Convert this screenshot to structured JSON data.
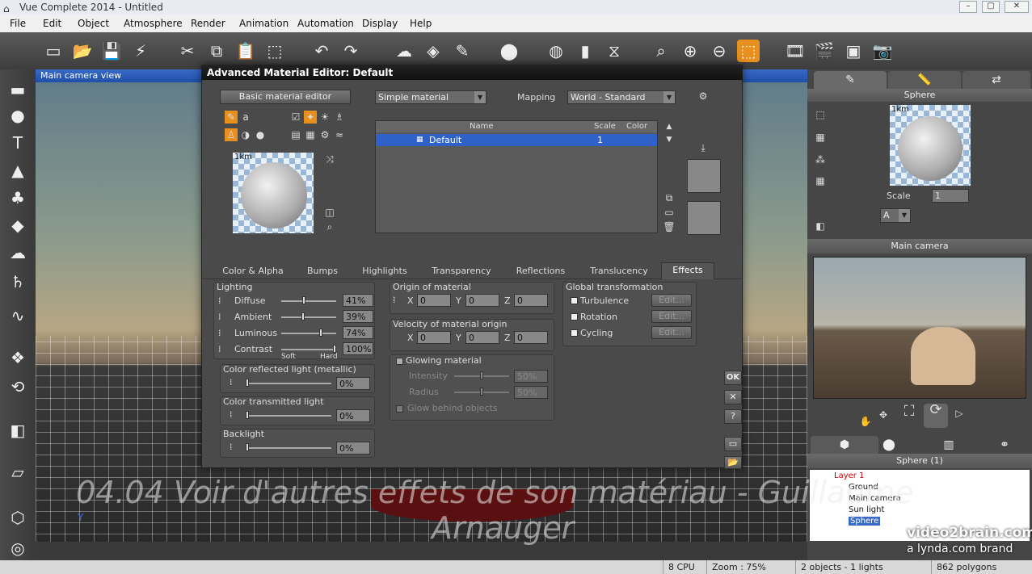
{
  "window": {
    "title": "Vue Complete 2014 - Untitled"
  },
  "menu": [
    "File",
    "Edit",
    "Object",
    "Atmosphere",
    "Render",
    "Animation",
    "Automation",
    "Display",
    "Help"
  ],
  "viewport": {
    "title": "Main camera view",
    "axis_y": "Y"
  },
  "dialog": {
    "title": "Advanced Material Editor: Default",
    "basic_editor_label": "Basic material editor",
    "material_type": "Simple material",
    "mapping_label": "Mapping",
    "mapping_value": "World - Standard",
    "preview_scale": "1km",
    "layers_table": {
      "columns": [
        "Name",
        "Scale",
        "Color"
      ],
      "rows": [
        {
          "name": "Default",
          "scale": "1",
          "color": ""
        }
      ]
    },
    "tabs": [
      "Color & Alpha",
      "Bumps",
      "Highlights",
      "Transparency",
      "Reflections",
      "Translucency",
      "Effects"
    ],
    "active_tab": "Effects",
    "lighting": {
      "title": "Lighting",
      "diffuse": {
        "label": "Diffuse",
        "value": "41%",
        "level": 0.41
      },
      "ambient": {
        "label": "Ambient",
        "value": "39%",
        "level": 0.39
      },
      "luminous": {
        "label": "Luminous",
        "value": "74%",
        "level": 0.74
      },
      "contrast": {
        "label": "Contrast",
        "value": "100%",
        "level": 1.0
      },
      "soft": "Soft",
      "hard": "Hard"
    },
    "color_reflected": {
      "label": "Color reflected light (metallic)",
      "value": "0%"
    },
    "color_transmitted": {
      "label": "Color transmitted light",
      "value": "0%"
    },
    "backlight": {
      "label": "Backlight",
      "value": "0%"
    },
    "origin": {
      "title": "Origin of material",
      "x": "0",
      "y": "0",
      "z": "0"
    },
    "velocity": {
      "title": "Velocity of material origin",
      "x": "0",
      "y": "0",
      "z": "0"
    },
    "glowing": {
      "label": "Glowing material",
      "intensity_label": "Intensity",
      "intensity_value": "50%",
      "radius_label": "Radius",
      "radius_value": "50%",
      "behind_label": "Glow behind objects"
    },
    "global_transform": {
      "title": "Global transformation",
      "turbulence": "Turbulence",
      "rotation": "Rotation",
      "cycling": "Cycling",
      "edit": "Edit..."
    },
    "axis": {
      "x": "X",
      "y": "Y",
      "z": "Z"
    },
    "ok": "OK"
  },
  "right_panel": {
    "material_title": "Sphere",
    "preview_scale": "1km",
    "scale_label": "Scale",
    "scale_value": "1",
    "layer_combo": "A",
    "camera_title": "Main camera",
    "world_title": "Sphere (1)",
    "tree": [
      "Layer 1",
      "Ground",
      "Main camera",
      "Sun light",
      "Sphere"
    ]
  },
  "watermark": {
    "line1": "04.04 Voir d'autres effets de son matériau - Guillaume",
    "line2": "Arnauger",
    "brand1": "video2brain.com",
    "brand2": "a lynda.com brand"
  },
  "status": {
    "cpu": "8 CPU",
    "zoom": "Zoom : 75%",
    "objects": "2 objects - 1 lights",
    "polygons": "862 polygons"
  }
}
